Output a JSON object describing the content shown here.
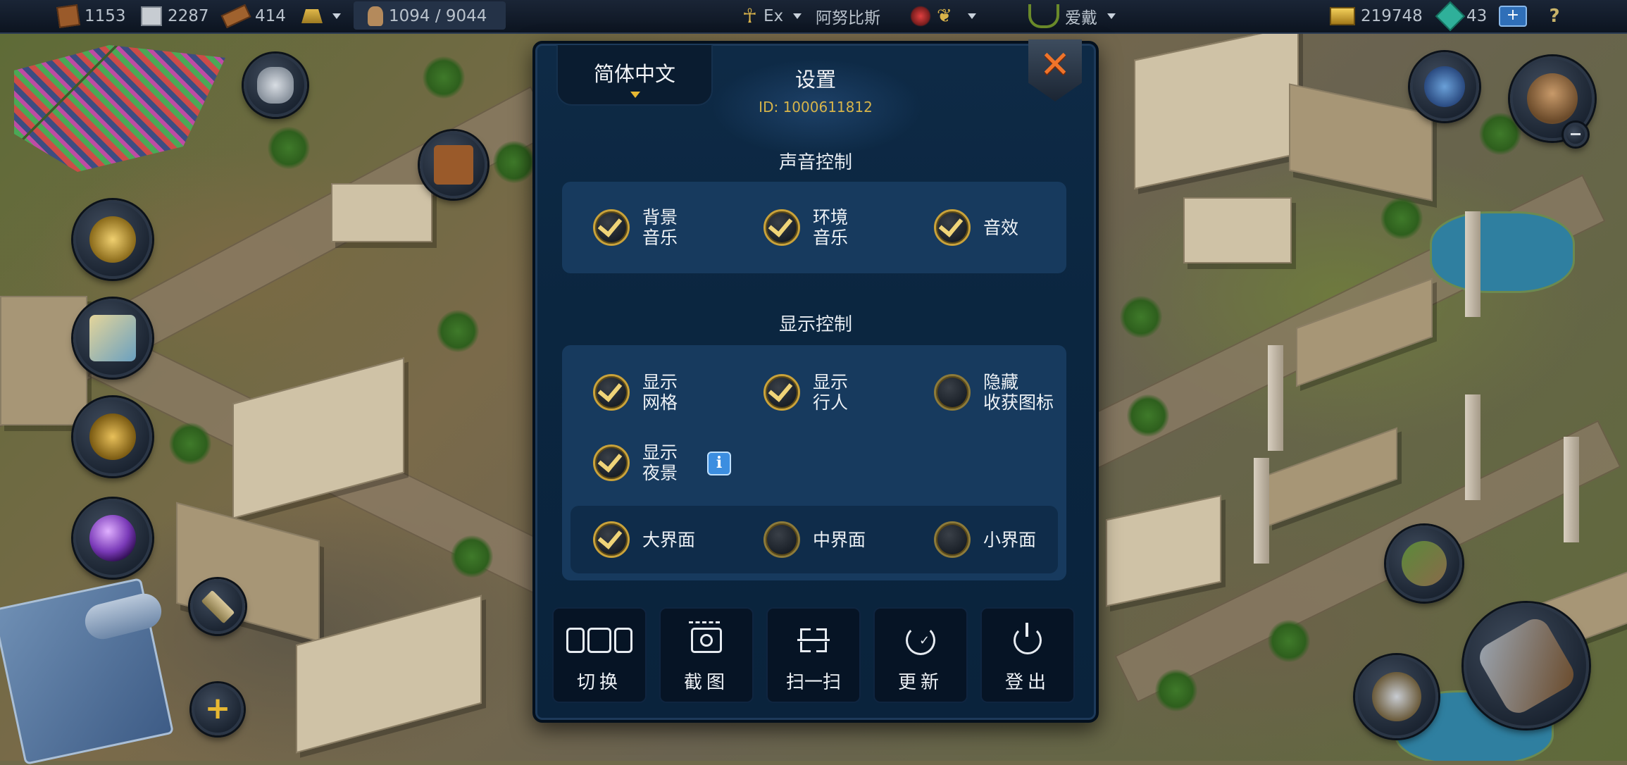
{
  "topbar": {
    "resources": [
      {
        "icon": "crate-icon",
        "value": "1153"
      },
      {
        "icon": "stone-icon",
        "value": "2287"
      },
      {
        "icon": "plank-icon",
        "value": "414"
      }
    ],
    "population": "1094 / 9044",
    "deity": {
      "label": "Ex",
      "city": "阿努比斯"
    },
    "ruler": "爱戴",
    "gold": "219748",
    "gems": "43",
    "help": "?"
  },
  "dialog": {
    "language": "简体中文",
    "title": "设置",
    "player_id": "ID: 1000611812",
    "sound": {
      "title": "声音控制",
      "options": [
        {
          "label": "背景\n音乐",
          "checked": true
        },
        {
          "label": "环境\n音乐",
          "checked": true
        },
        {
          "label": "音效",
          "checked": true
        }
      ]
    },
    "display": {
      "title": "显示控制",
      "options": [
        {
          "label": "显示\n网格",
          "checked": true
        },
        {
          "label": "显示\n行人",
          "checked": true
        },
        {
          "label": "隐藏\n收获图标",
          "checked": false
        },
        {
          "label": "显示\n夜景",
          "checked": true
        }
      ],
      "info_icon": "i",
      "ui_size": [
        {
          "label": "大界面",
          "selected": true
        },
        {
          "label": "中界面",
          "selected": false
        },
        {
          "label": "小界面",
          "selected": false
        }
      ]
    },
    "actions": [
      {
        "label": "切换",
        "icon": "switch-account-icon"
      },
      {
        "label": "截图",
        "icon": "screenshot-icon"
      },
      {
        "label": "扫一扫",
        "icon": "scan-icon"
      },
      {
        "label": "更新",
        "icon": "update-icon"
      },
      {
        "label": "登出",
        "icon": "power-icon"
      }
    ]
  },
  "colors": {
    "dialog_bg": "#0b2640",
    "panel_bg": "#173a5e",
    "accent_gold": "#d6b44a",
    "close_orange": "#f0742a"
  }
}
